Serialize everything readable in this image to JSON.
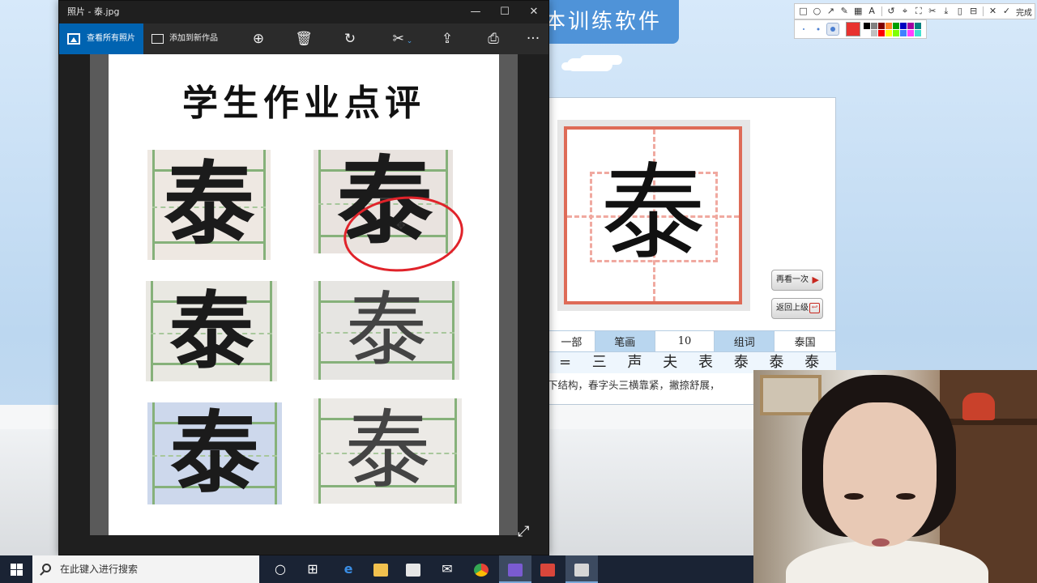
{
  "background_app": {
    "title": "本训练软件",
    "character": "泰",
    "replay_button": "再看一次",
    "back_button": "返回上级",
    "info": {
      "radical_suffix": "一部",
      "strokes_label": "笔画",
      "strokes_value": "10",
      "words_label": "组词",
      "words_value": "泰国"
    },
    "stroke_order": "= 三 声 夫 表 泰 泰 泰 泰",
    "description": "下结构，春字头三横靠紧，撇捺舒展，"
  },
  "annotation_toolbar": {
    "tools": [
      "rectangle-icon",
      "ellipse-icon",
      "arrow-icon",
      "pen-icon",
      "mosaic-icon",
      "text-icon",
      "undo-icon",
      "pin-icon",
      "fullscreen-icon",
      "pin-clear-icon",
      "download-icon",
      "save-icon",
      "bookmark-icon",
      "close-icon",
      "check-icon"
    ],
    "done_label": "完成",
    "current_color": "#e8322e",
    "swatches": [
      "#000000",
      "#808080",
      "#7f0000",
      "#ff7f27",
      "#00a000",
      "#0000c0",
      "#a000a0",
      "#008080",
      "#ffffff",
      "#c0c0c0",
      "#ff0000",
      "#ffff00",
      "#80ff00",
      "#4080ff",
      "#ff40ff",
      "#40e0d0"
    ]
  },
  "photos_window": {
    "title": "照片 - 泰.jpg",
    "controls": {
      "minimize": "—",
      "maximize": "☐",
      "close": "✕"
    },
    "toolbar": {
      "view_all": "查看所有照片",
      "add_to_creation": "添加到新作品",
      "more": "···"
    },
    "worksheet": {
      "title": "学生作业点评",
      "sample_char": "泰"
    }
  },
  "taskbar": {
    "search_placeholder": "在此键入进行搜索"
  }
}
